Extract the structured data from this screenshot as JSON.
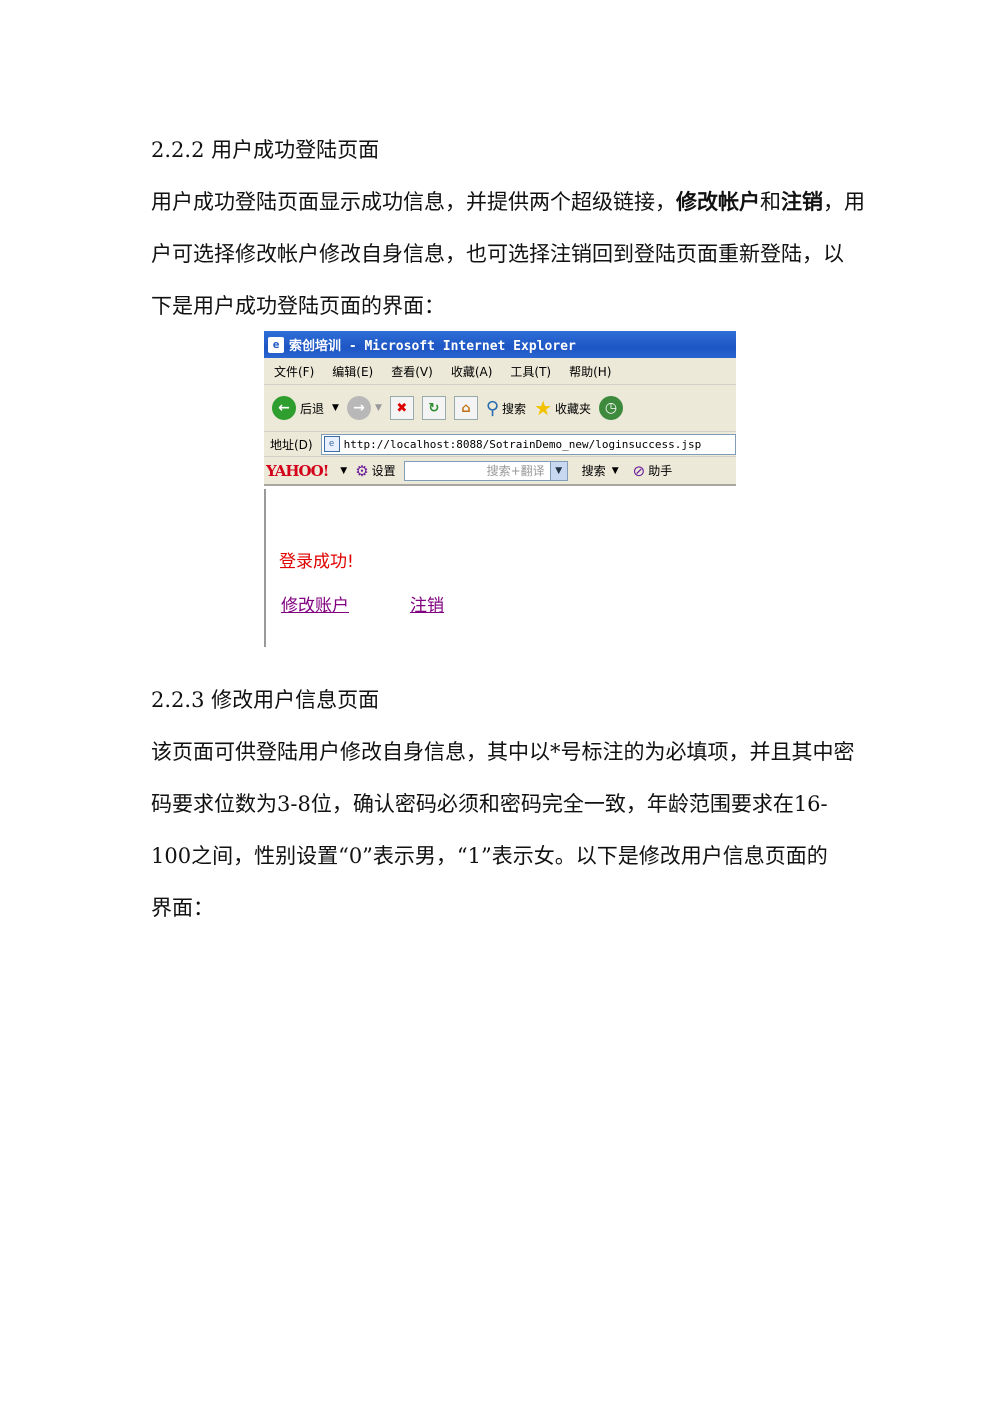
{
  "section1": {
    "heading": "2.2.2 用户成功登陆页面",
    "line1_a": "用户成功登陆页面显示成功信息，并提供两个超级链接，",
    "line1_b1": "修改帐户",
    "line1_c": "和",
    "line1_b2": "注销",
    "line1_d": "，用",
    "line2": "户可选择修改帐户修改自身信息，也可选择注销回到登陆页面重新登陆，以",
    "line3": "下是用户成功登陆页面的界面："
  },
  "browser": {
    "title": "索创培训 - Microsoft Internet Explorer",
    "menu": [
      "文件(F)",
      "编辑(E)",
      "查看(V)",
      "收藏(A)",
      "工具(T)",
      "帮助(H)"
    ],
    "back_label": "后退",
    "search_label": "搜索",
    "favorites_label": "收藏夹",
    "address_label": "地址(D)",
    "address_value": "http://localhost:8088/SotrainDemo_new/loginsuccess.jsp",
    "yahoo_logo": "YAHOO!",
    "settings_label": "设置",
    "search_placeholder": "搜索+翻译",
    "search_button": "搜索",
    "helper_label": "助手",
    "success_message": "登录成功!",
    "link_modify": "修改账户",
    "link_logout": "注销"
  },
  "section2": {
    "heading": "2.2.3 修改用户信息页面",
    "line1": "该页面可供登陆用户修改自身信息，其中以*号标注的为必填项，并且其中密",
    "line2": "码要求位数为3-8位，确认密码必须和密码完全一致，年龄范围要求在16-",
    "line3": "100之间，性别设置“0”表示男，“1”表示女。以下是修改用户信息页面的",
    "line4": "界面："
  }
}
